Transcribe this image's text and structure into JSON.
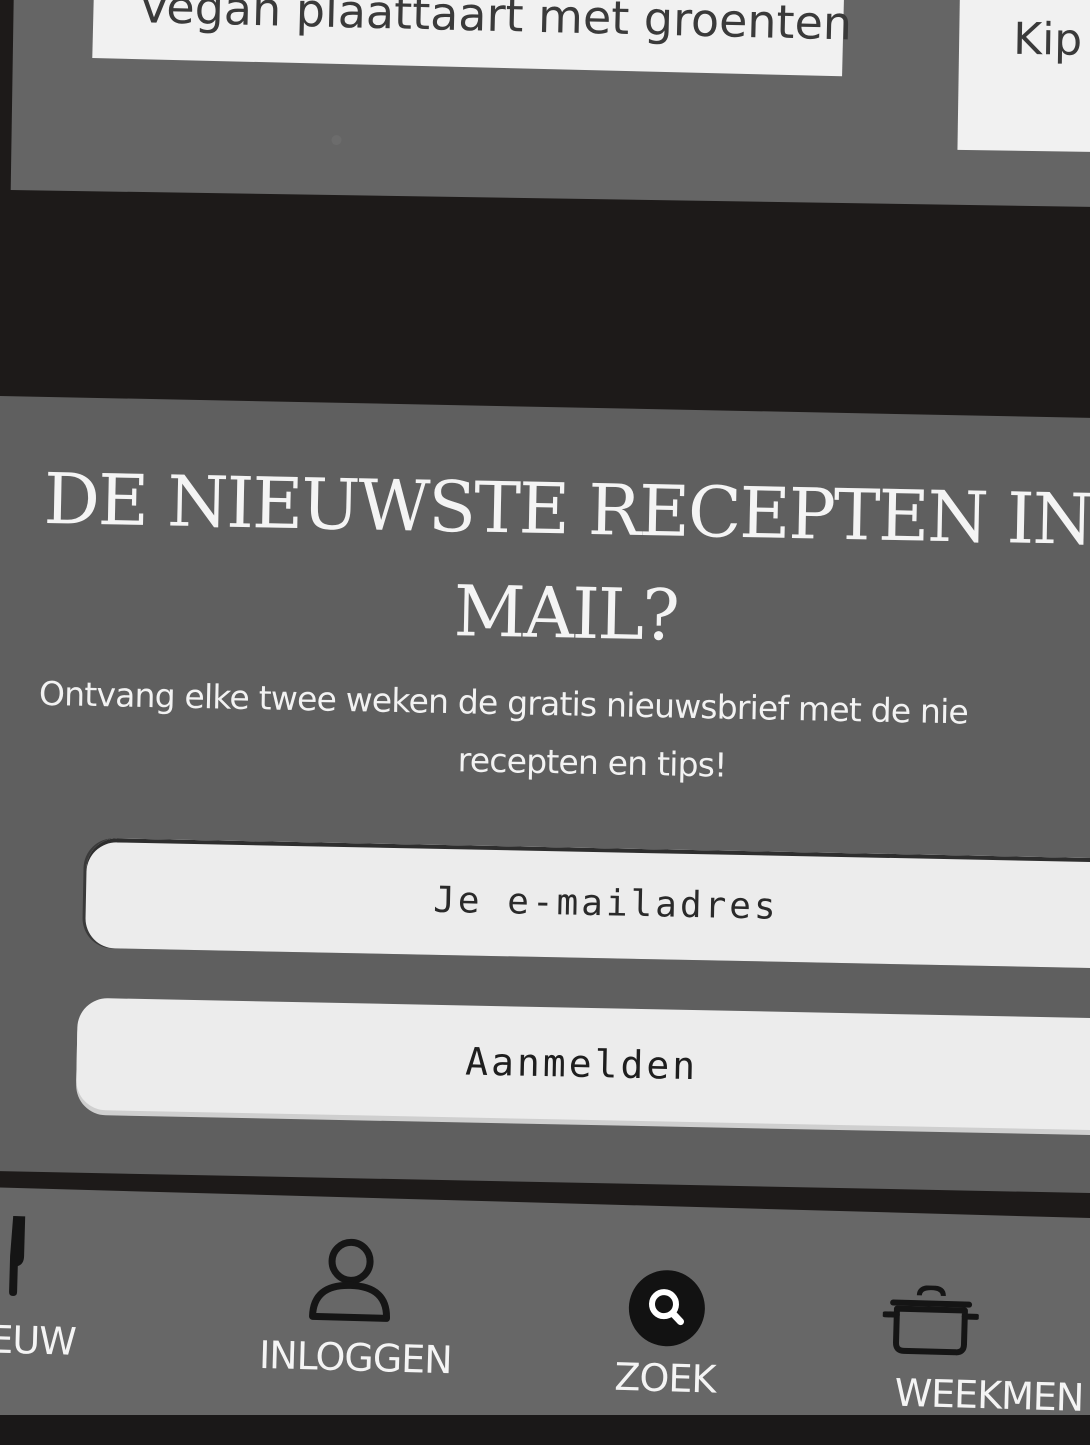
{
  "recipe_cards": [
    {
      "title": "Vegan plaattaart met groenten"
    },
    {
      "title": "Kip"
    }
  ],
  "newsletter": {
    "title": "DE NIEUWSTE RECEPTEN IN MAIL?",
    "text_line1": "Ontvang elke twee weken de gratis nieuwsbrief met de nie",
    "text_line2": "recepten en tips!",
    "email_placeholder": "Je e-mailadres",
    "signup_label": "Aanmelden"
  },
  "bottom_nav": {
    "items": [
      {
        "label": "EUW",
        "icon": "cutlery-icon"
      },
      {
        "label": "INLOGGEN",
        "icon": "user-icon"
      },
      {
        "label": "ZOEK",
        "icon": "search-icon"
      },
      {
        "label": "WEEKMEN",
        "icon": "cooking-pot-icon"
      }
    ]
  },
  "colors": {
    "panel": "#5f5f5f",
    "nav": "#676767",
    "card": "#f1f1f1",
    "field": "#ececec",
    "background": "#1d1a19"
  }
}
